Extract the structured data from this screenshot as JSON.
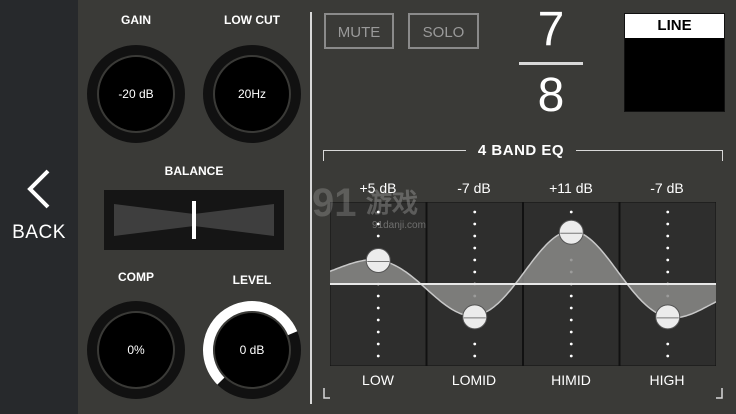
{
  "back": {
    "label": "BACK"
  },
  "knobs": {
    "gain": {
      "label": "GAIN",
      "value": "-20 dB"
    },
    "low_cut": {
      "label": "LOW CUT",
      "value": "20Hz"
    },
    "comp": {
      "label": "COMP",
      "value": "0%"
    },
    "level": {
      "label": "LEVEL",
      "value": "0 dB",
      "fill_fraction": 0.75
    }
  },
  "balance": {
    "label": "BALANCE",
    "position": 0.5
  },
  "buttons": {
    "mute": "MUTE",
    "solo": "SOLO"
  },
  "channel": {
    "top": "7",
    "bottom": "8"
  },
  "input_type": {
    "label": "LINE"
  },
  "eq": {
    "title": "4 BAND EQ",
    "bands": [
      {
        "name": "LOW",
        "gain_label": "+5 dB",
        "gain": 5
      },
      {
        "name": "LOMID",
        "gain_label": "-7 dB",
        "gain": -7
      },
      {
        "name": "HIMID",
        "gain_label": "+11 dB",
        "gain": 11
      },
      {
        "name": "HIGH",
        "gain_label": "-7 dB",
        "gain": -7
      }
    ]
  },
  "watermark": {
    "text": "游戏",
    "subtext": "91danji.com"
  },
  "colors": {
    "background": "#3a3a37",
    "panel": "#27292c",
    "eq_fill": "#8a8a88",
    "knob_ring": "#ffffff"
  }
}
